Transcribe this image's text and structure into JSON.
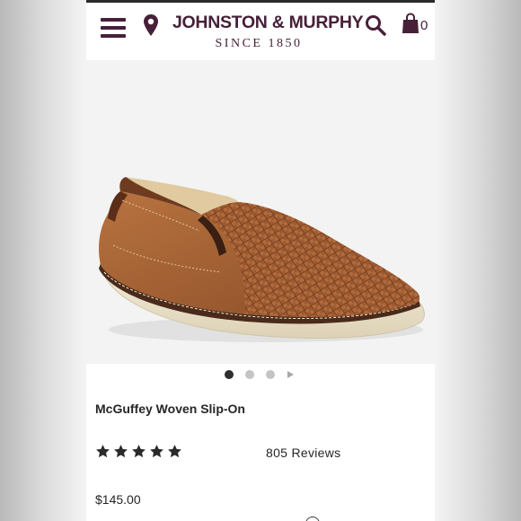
{
  "header": {
    "logo_main": "JOHNSTON & MURPHY",
    "logo_sub": "SINCE 1850",
    "cart_count": "0",
    "icons": [
      "menu-icon",
      "location-pin-icon",
      "search-icon",
      "shopping-bag-icon"
    ]
  },
  "carousel": {
    "image": "brown woven leather slip-on shoe",
    "slide_count": 3,
    "active_slide": 1
  },
  "product": {
    "name": "McGuffey Woven Slip-On",
    "rating": 5,
    "reviews_label": "805 Reviews",
    "price": "$145.00"
  },
  "colors": {
    "brand": "#462038",
    "text": "#262626",
    "leather": "#9a5a32",
    "sole": "#ece2c9"
  }
}
